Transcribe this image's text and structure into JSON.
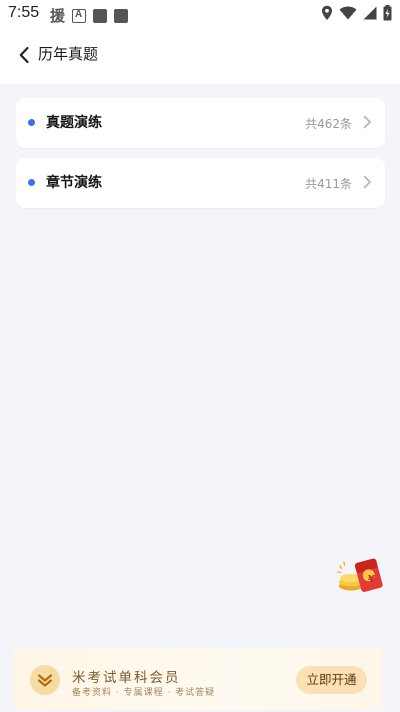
{
  "status_bar": {
    "time": "7:55",
    "glyph": "援",
    "icons": [
      "a-box-icon",
      "square-icon",
      "square-icon",
      "location-icon",
      "wifi-icon",
      "signal-icon",
      "battery-icon"
    ]
  },
  "header": {
    "title": "历年真题",
    "back_icon": "chevron-left-icon"
  },
  "list": [
    {
      "label": "真题演练",
      "count": "共462条",
      "icon": "chevron-right-icon"
    },
    {
      "label": "章节演练",
      "count": "共411条",
      "icon": "chevron-right-icon"
    }
  ],
  "floating_promo": {
    "icon": "red-envelope-icon",
    "symbol": "¥"
  },
  "banner": {
    "title": "米考试单科会员",
    "subtitle": "备考资料 · 专属课程 · 考试答疑",
    "button_label": "立即开通",
    "icon": "vip-chevron-down-icon"
  },
  "colors": {
    "accent": "#3d6fe8",
    "page_bg": "#f4f5fa",
    "banner_bg": "#fff6e7",
    "button_bg": "#fbe0b6",
    "envelope_red": "#e23a34"
  }
}
